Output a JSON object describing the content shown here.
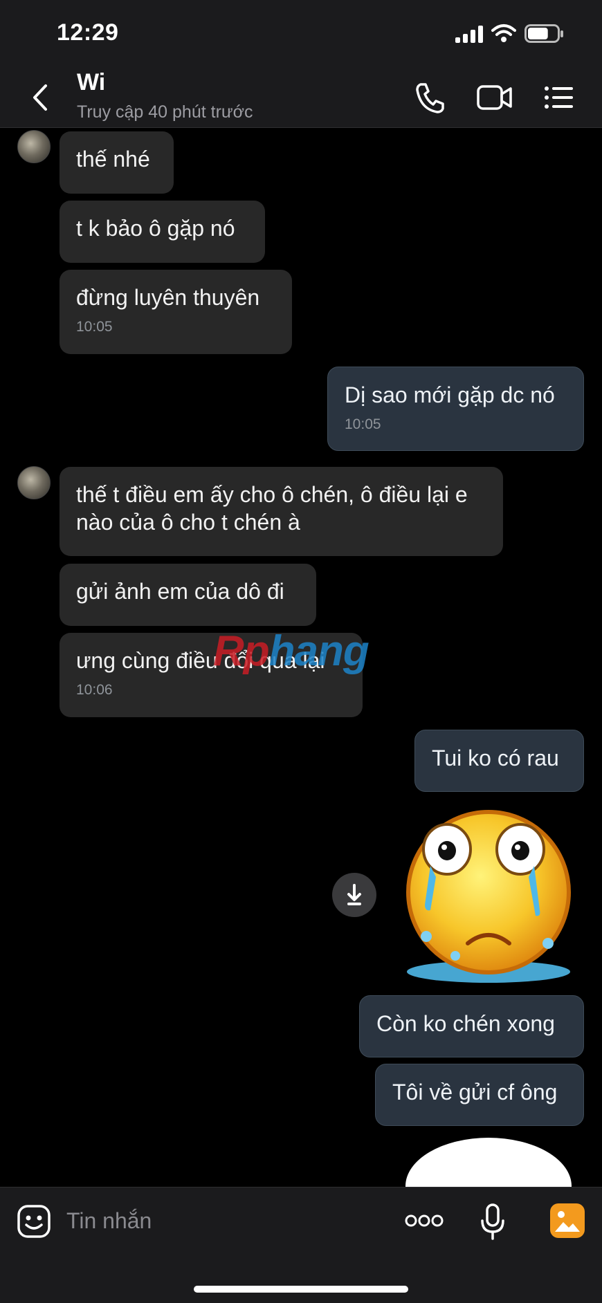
{
  "status_bar": {
    "time": "12:29",
    "battery_level": 0.7
  },
  "header": {
    "contact_name": "Wi",
    "last_seen": "Truy cập 40 phút trước",
    "icons": [
      "back-icon",
      "phone-icon",
      "video-call-icon",
      "list-menu-icon"
    ]
  },
  "messages": [
    {
      "side": "in",
      "text": "thế nhé"
    },
    {
      "side": "in",
      "text": "t k bảo ô gặp nó"
    },
    {
      "side": "in",
      "text": "đừng luyên thuyên",
      "time": "10:05"
    },
    {
      "side": "out",
      "text": "Dị sao mới gặp dc nó",
      "time": "10:05"
    },
    {
      "side": "in",
      "text": "thế t điều em ấy cho ô chén, ô điều lại e nào của ô cho t chén à"
    },
    {
      "side": "in",
      "text": "gửi ảnh em của dô đi"
    },
    {
      "side": "in",
      "text": "ưng cùng điều đổi qua lại",
      "time": "10:06"
    },
    {
      "side": "out",
      "text": "Tui ko có rau"
    },
    {
      "side": "out",
      "type": "sticker",
      "sticker": "crying-face-sticker"
    },
    {
      "side": "out",
      "text": "Còn ko chén xong"
    },
    {
      "side": "out",
      "text": "Tôi về gửi cf ông"
    }
  ],
  "watermark": {
    "part1": "Rp",
    "part2": "hang"
  },
  "input_bar": {
    "placeholder": "Tin nhắn",
    "icons": [
      "emoji-icon",
      "more-icon",
      "microphone-icon",
      "image-icon"
    ],
    "image_icon_color": "#f39a1e"
  },
  "colors": {
    "incoming_bubble": "#282828",
    "outgoing_bubble": "#2a3440",
    "background": "#000000"
  }
}
